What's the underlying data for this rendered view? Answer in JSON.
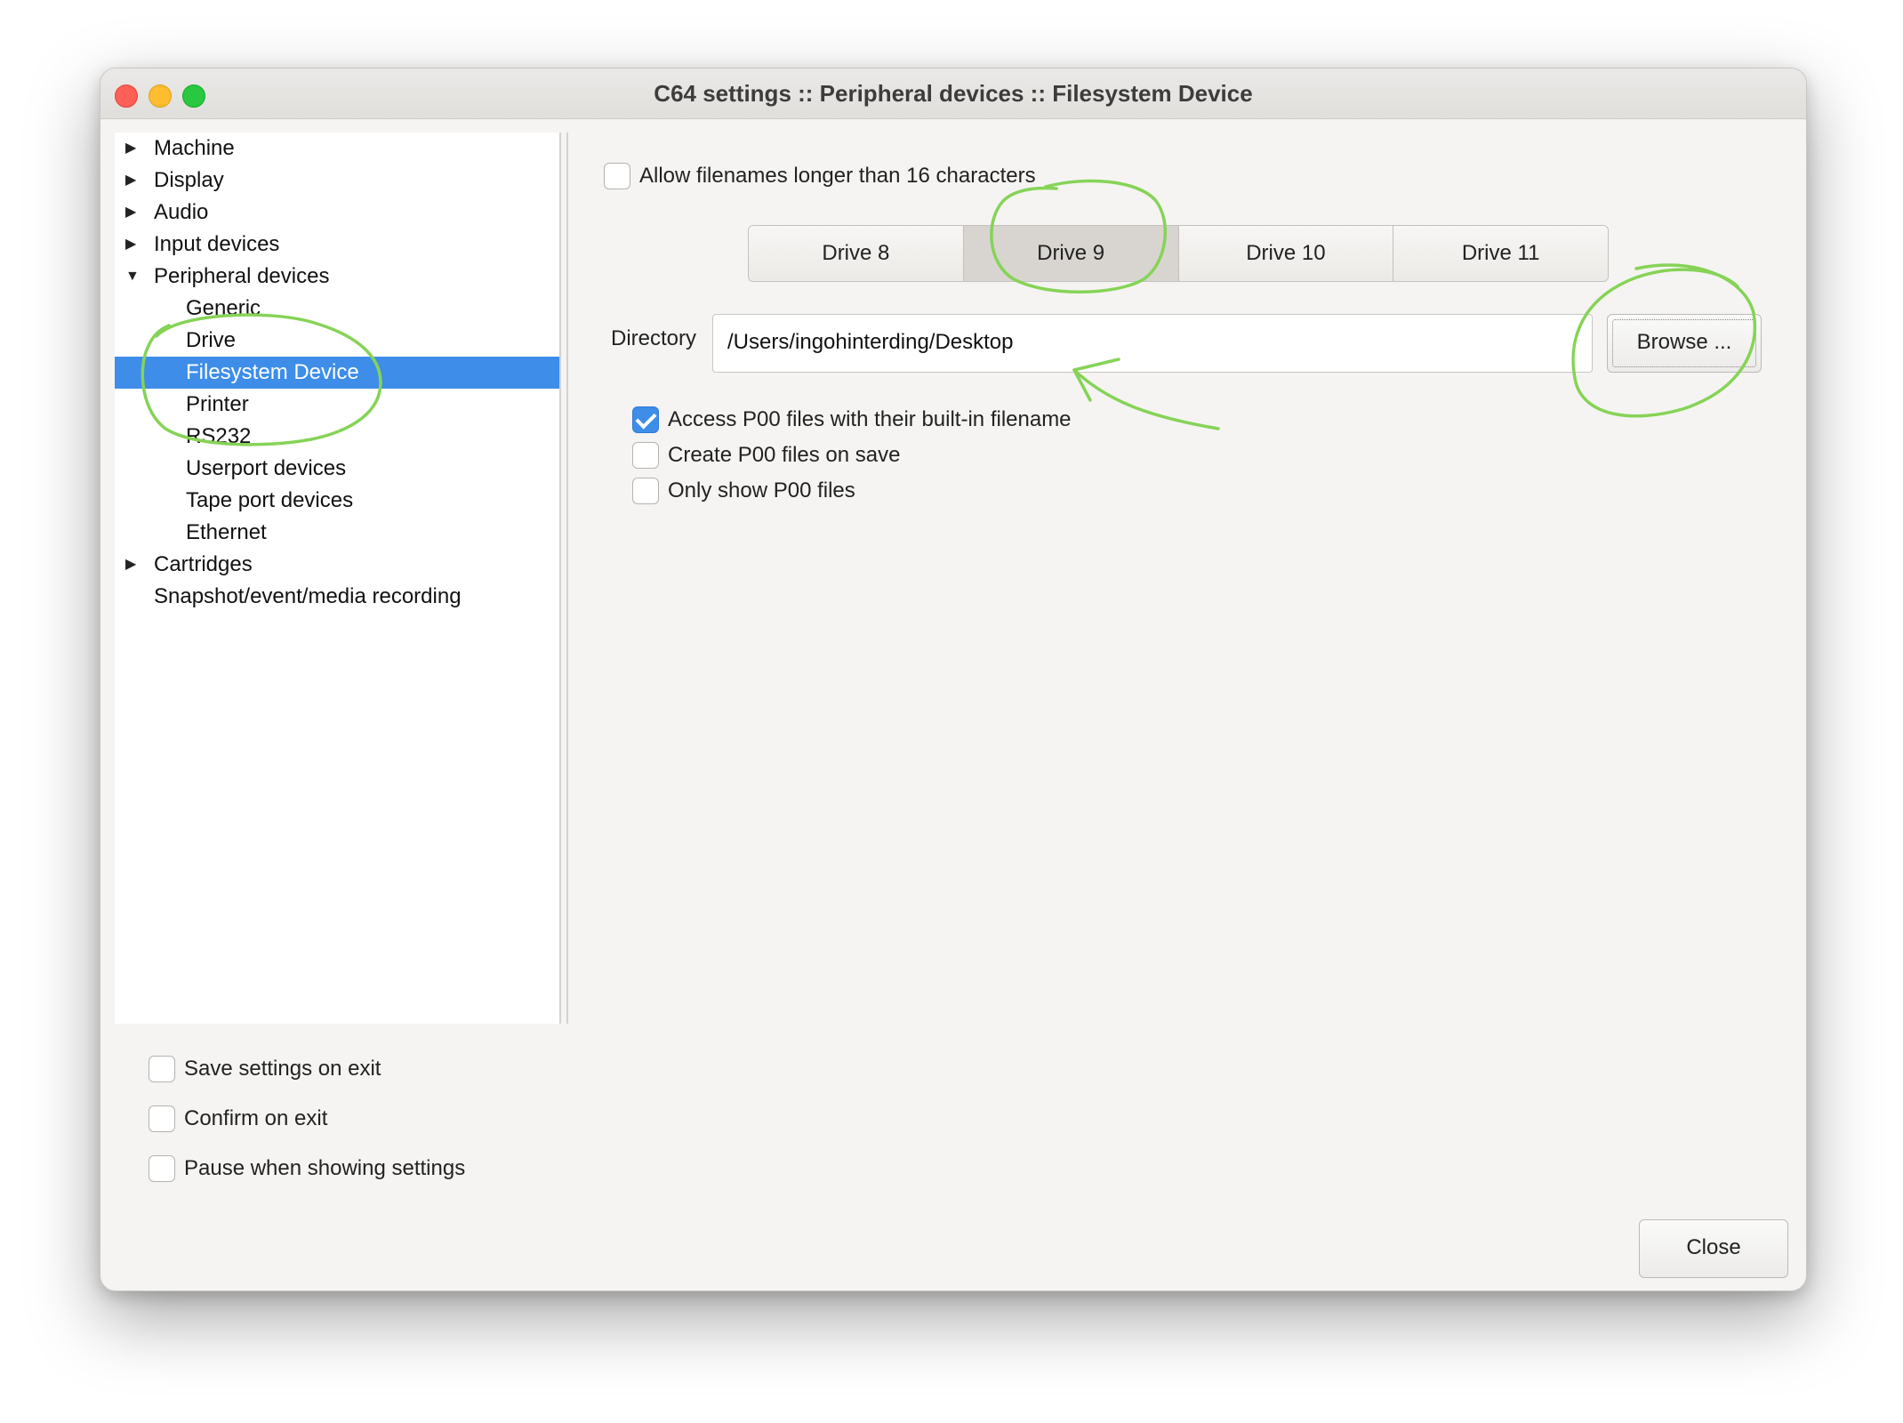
{
  "window": {
    "title": "C64 settings :: Peripheral devices :: Filesystem Device"
  },
  "tree": {
    "items": [
      {
        "label": "Machine",
        "arrow": "▶"
      },
      {
        "label": "Display",
        "arrow": "▶"
      },
      {
        "label": "Audio",
        "arrow": "▶"
      },
      {
        "label": "Input devices",
        "arrow": "▶"
      },
      {
        "label": "Peripheral devices",
        "arrow": "▼"
      },
      {
        "label": "Generic",
        "arrow": ""
      },
      {
        "label": "Drive",
        "arrow": ""
      },
      {
        "label": "Filesystem Device",
        "arrow": ""
      },
      {
        "label": "Printer",
        "arrow": ""
      },
      {
        "label": "RS232",
        "arrow": ""
      },
      {
        "label": "Userport devices",
        "arrow": ""
      },
      {
        "label": "Tape port devices",
        "arrow": ""
      },
      {
        "label": "Ethernet",
        "arrow": ""
      },
      {
        "label": "Cartridges",
        "arrow": "▶"
      },
      {
        "label": "Snapshot/event/media recording",
        "arrow": ""
      }
    ],
    "selected": "Filesystem Device"
  },
  "settings": {
    "allow_long_filenames": {
      "label": "Allow filenames longer than 16 characters",
      "checked": false
    },
    "drive_tabs": [
      "Drive 8",
      "Drive 9",
      "Drive 10",
      "Drive 11"
    ],
    "active_tab": "Drive 9",
    "directory_label": "Directory",
    "directory_value": "/Users/ingohinterding/Desktop",
    "browse_label": "Browse ...",
    "p00_options": [
      {
        "label": "Access P00 files with their built-in filename",
        "checked": true
      },
      {
        "label": "Create P00 files on save",
        "checked": false
      },
      {
        "label": "Only show P00 files",
        "checked": false
      }
    ]
  },
  "footer": {
    "options": [
      {
        "label": "Save settings on exit",
        "checked": false
      },
      {
        "label": "Confirm on exit",
        "checked": false
      },
      {
        "label": "Pause when showing settings",
        "checked": false
      }
    ],
    "close_label": "Close"
  },
  "colors": {
    "selection": "#3d8de9",
    "annotation": "#86d357"
  }
}
